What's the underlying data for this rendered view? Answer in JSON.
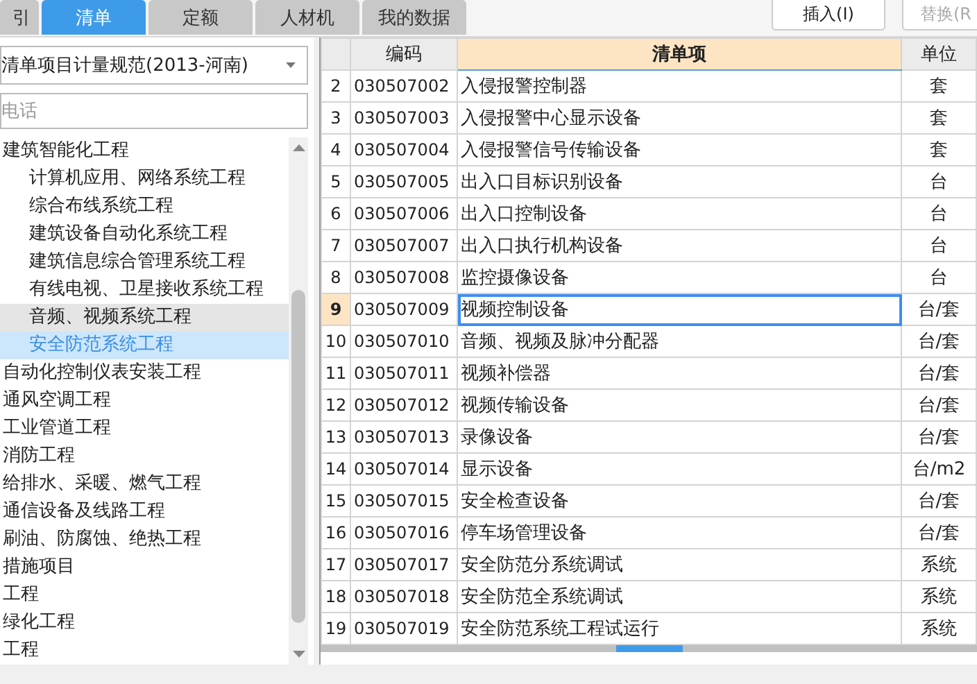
{
  "tabs": [
    {
      "label": "引",
      "selected": false
    },
    {
      "label": "清单",
      "selected": true
    },
    {
      "label": "定额",
      "selected": false
    },
    {
      "label": "人材机",
      "selected": false
    },
    {
      "label": "我的数据",
      "selected": false
    }
  ],
  "toolbar_buttons": [
    {
      "label": "插入(I)",
      "disabled": false
    },
    {
      "label": "替换(R",
      "disabled": true
    }
  ],
  "standard_select": {
    "value": "清单项目计量规范(2013-河南)"
  },
  "search": {
    "placeholder": "电话"
  },
  "tree": [
    {
      "label": "建筑智能化工程",
      "selected": false,
      "hovered": false,
      "children": [
        {
          "label": "计算机应用、网络系统工程",
          "selected": false,
          "hovered": false
        },
        {
          "label": "综合布线系统工程",
          "selected": false,
          "hovered": false
        },
        {
          "label": "建筑设备自动化系统工程",
          "selected": false,
          "hovered": false
        },
        {
          "label": "建筑信息综合管理系统工程",
          "selected": false,
          "hovered": false
        },
        {
          "label": "有线电视、卫星接收系统工程",
          "selected": false,
          "hovered": false
        },
        {
          "label": "音频、视频系统工程",
          "selected": false,
          "hovered": true
        },
        {
          "label": "安全防范系统工程",
          "selected": true,
          "hovered": false
        }
      ]
    },
    {
      "label": "自动化控制仪表安装工程",
      "selected": false,
      "hovered": false
    },
    {
      "label": "通风空调工程",
      "selected": false,
      "hovered": false
    },
    {
      "label": "工业管道工程",
      "selected": false,
      "hovered": false
    },
    {
      "label": "消防工程",
      "selected": false,
      "hovered": false
    },
    {
      "label": "给排水、采暖、燃气工程",
      "selected": false,
      "hovered": false
    },
    {
      "label": "通信设备及线路工程",
      "selected": false,
      "hovered": false
    },
    {
      "label": "刷油、防腐蚀、绝热工程",
      "selected": false,
      "hovered": false
    },
    {
      "label": "措施项目",
      "selected": false,
      "hovered": false
    },
    {
      "label": "工程",
      "selected": false,
      "hovered": false
    },
    {
      "label": "绿化工程",
      "selected": false,
      "hovered": false
    },
    {
      "label": "工程",
      "selected": false,
      "hovered": false
    }
  ],
  "table": {
    "columns": [
      {
        "label": "编码",
        "active": false
      },
      {
        "label": "清单项",
        "active": true
      },
      {
        "label": "单位",
        "active": false
      }
    ],
    "rows": [
      {
        "number": "2",
        "code": "030507002",
        "name": "入侵报警控制器",
        "unit": "套",
        "selected": false
      },
      {
        "number": "3",
        "code": "030507003",
        "name": "入侵报警中心显示设备",
        "unit": "套",
        "selected": false
      },
      {
        "number": "4",
        "code": "030507004",
        "name": "入侵报警信号传输设备",
        "unit": "套",
        "selected": false
      },
      {
        "number": "5",
        "code": "030507005",
        "name": "出入口目标识别设备",
        "unit": "台",
        "selected": false
      },
      {
        "number": "6",
        "code": "030507006",
        "name": "出入口控制设备",
        "unit": "台",
        "selected": false
      },
      {
        "number": "7",
        "code": "030507007",
        "name": "出入口执行机构设备",
        "unit": "台",
        "selected": false
      },
      {
        "number": "8",
        "code": "030507008",
        "name": "监控摄像设备",
        "unit": "台",
        "selected": false
      },
      {
        "number": "9",
        "code": "030507009",
        "name": "视频控制设备",
        "unit": "台/套",
        "selected": true
      },
      {
        "number": "10",
        "code": "030507010",
        "name": "音频、视频及脉冲分配器",
        "unit": "台/套",
        "selected": false
      },
      {
        "number": "11",
        "code": "030507011",
        "name": "视频补偿器",
        "unit": "台/套",
        "selected": false
      },
      {
        "number": "12",
        "code": "030507012",
        "name": "视频传输设备",
        "unit": "台/套",
        "selected": false
      },
      {
        "number": "13",
        "code": "030507013",
        "name": "录像设备",
        "unit": "台/套",
        "selected": false
      },
      {
        "number": "14",
        "code": "030507014",
        "name": "显示设备",
        "unit": "台/m2",
        "selected": false
      },
      {
        "number": "15",
        "code": "030507015",
        "name": "安全检查设备",
        "unit": "台/套",
        "selected": false
      },
      {
        "number": "16",
        "code": "030507016",
        "name": "停车场管理设备",
        "unit": "台/套",
        "selected": false
      },
      {
        "number": "17",
        "code": "030507017",
        "name": "安全防范分系统调试",
        "unit": "系统",
        "selected": false
      },
      {
        "number": "18",
        "code": "030507018",
        "name": "安全防范全系统调试",
        "unit": "系统",
        "selected": false
      },
      {
        "number": "19",
        "code": "030507019",
        "name": "安全防范系统工程试运行",
        "unit": "系统",
        "selected": false
      }
    ]
  }
}
